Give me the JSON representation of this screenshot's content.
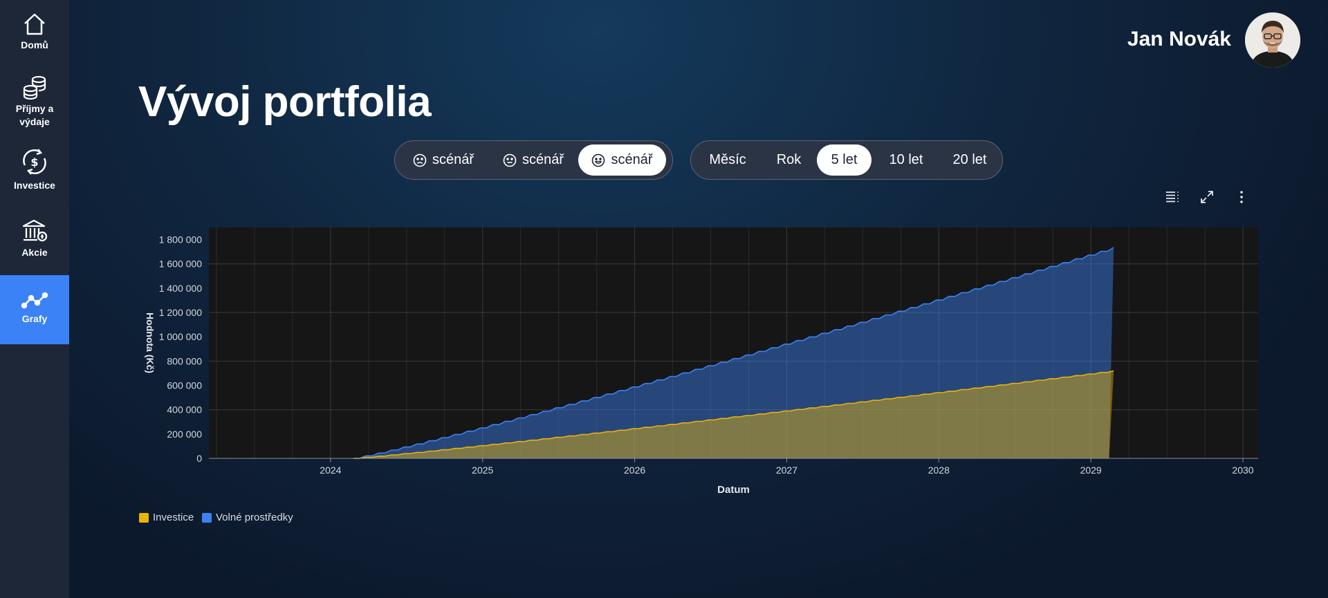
{
  "sidebar": {
    "items": [
      {
        "label": "Domů",
        "icon": "home-icon"
      },
      {
        "label": "Příjmy a výdaje",
        "icon": "coins-icon"
      },
      {
        "label": "Investice",
        "icon": "currency-cycle-icon"
      },
      {
        "label": "Akcie",
        "icon": "bank-icon"
      },
      {
        "label": "Grafy",
        "icon": "line-chart-icon",
        "active": true
      }
    ]
  },
  "header": {
    "user_name": "Jan Novák"
  },
  "page": {
    "title": "Vývoj portfolia"
  },
  "scenarios": {
    "items": [
      {
        "label": "scénář",
        "icon": "sad-face-icon"
      },
      {
        "label": "scénář",
        "icon": "neutral-face-icon"
      },
      {
        "label": "scénář",
        "icon": "happy-face-icon",
        "active": true
      }
    ]
  },
  "periods": {
    "items": [
      {
        "label": "Měsíc"
      },
      {
        "label": "Rok"
      },
      {
        "label": "5 let",
        "active": true
      },
      {
        "label": "10 let"
      },
      {
        "label": "20 let"
      }
    ]
  },
  "toolbar": {
    "icons": [
      "list-icon",
      "expand-icon",
      "more-vertical-icon"
    ]
  },
  "colors": {
    "accent": "#3b82f6",
    "investice": "#eab308",
    "volne": "#3b82f6",
    "plot_bg": "#161616"
  },
  "chart_data": {
    "type": "area",
    "stacked": true,
    "xlabel": "Datum",
    "ylabel": "Hodnota (Kč)",
    "xlim": [
      2023.2,
      2030.1
    ],
    "ylim": [
      0,
      1900000
    ],
    "x_ticks": [
      "2024",
      "2025",
      "2026",
      "2027",
      "2028",
      "2029",
      "2030"
    ],
    "y_ticks": [
      "0",
      "200 000",
      "400 000",
      "600 000",
      "800 000",
      "1 000 000",
      "1 200 000",
      "1 400 000",
      "1 600 000",
      "1 800 000"
    ],
    "y_tick_values": [
      0,
      200000,
      400000,
      600000,
      800000,
      1000000,
      1200000,
      1400000,
      1600000,
      1800000
    ],
    "grid": true,
    "legend_position": "bottom-left",
    "series_start": 2024.15,
    "series_end": 2029.12,
    "series": [
      {
        "name": "Investice",
        "color": "#eab308",
        "end_value": 720000
      },
      {
        "name": "Volné prostředky",
        "color": "#3b82f6",
        "end_value": 1735000
      }
    ]
  }
}
